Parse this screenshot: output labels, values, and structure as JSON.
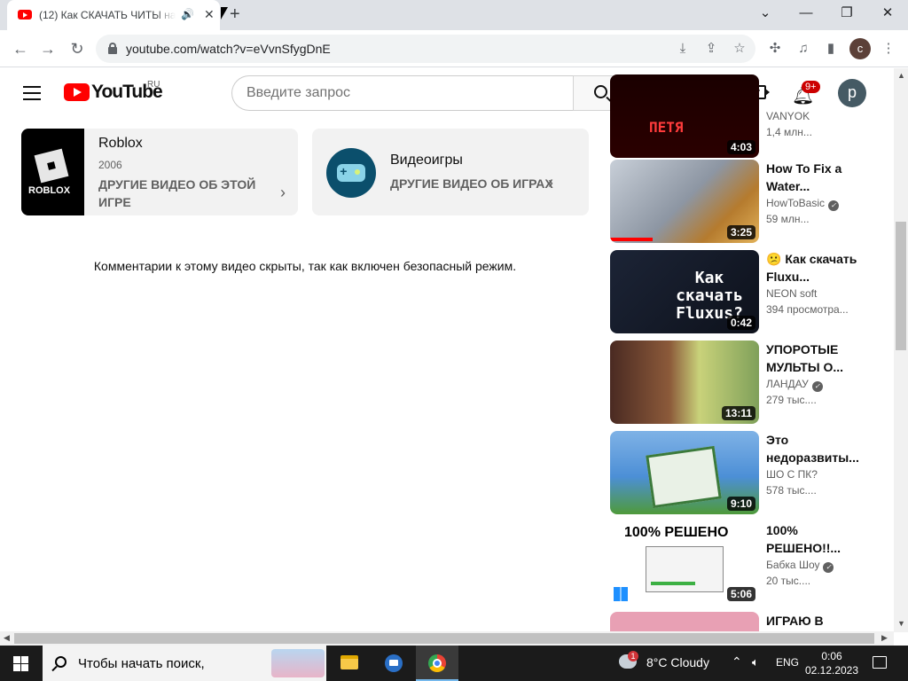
{
  "browser": {
    "tab_title": "(12) Как СКАЧАТЬ ЧИТЫ на",
    "url": "youtube.com/watch?v=eVvnSfygDnE",
    "profile_initial": "c",
    "window_controls": [
      "chevron-down",
      "minimize",
      "restore",
      "close"
    ]
  },
  "youtube": {
    "logo_text": "YouTube",
    "country": "RU",
    "search_placeholder": "Введите запрос",
    "notifications_badge": "9+",
    "avatar_initial": "p",
    "accent": "#ff0000"
  },
  "cards": {
    "roblox": {
      "thumb_label": "ROBLOX",
      "title": "Roblox",
      "year": "2006",
      "link": "ДРУГИЕ ВИДЕО ОБ ЭТОЙ ИГРЕ"
    },
    "games": {
      "title": "Видеоигры",
      "link": "ДРУГИЕ ВИДЕО ОБ ИГРАХ"
    }
  },
  "comments_notice": "Комментарии к этому видео скрыты, так как включен безопасный режим.",
  "recommended": [
    {
      "title": "",
      "thumb_text": "ПЕТЯ",
      "channel": "VANYOK",
      "verified": false,
      "views": "1,4 млн...",
      "duration": "4:03"
    },
    {
      "title": "How To Fix a Water...",
      "thumb_text": "",
      "channel": "HowToBasic",
      "verified": true,
      "views": "59 млн...",
      "duration": "3:25"
    },
    {
      "title": "😕 Как скачать Fluxu...",
      "thumb_text": "Как скачать Fluxus?",
      "channel": "NEON soft",
      "verified": false,
      "views": "394 просмотра...",
      "duration": "0:42"
    },
    {
      "title": "УПОРОТЫЕ МУЛЬТЫ О...",
      "thumb_text": "",
      "channel": "ЛАНДАУ",
      "verified": true,
      "views": "279 тыс....",
      "duration": "13:11"
    },
    {
      "title": "Это недоразвиты...",
      "thumb_text": "",
      "channel": "ШО С ПК?",
      "verified": false,
      "views": "578 тыс....",
      "duration": "9:10"
    },
    {
      "title": "100% РЕШЕНО!!...",
      "thumb_text": "100% РЕШЕНО",
      "channel": "Бабка Шоу",
      "verified": true,
      "views": "20 тыс....",
      "duration": "5:06"
    },
    {
      "title": "ИГРАЮ В",
      "thumb_text": "",
      "channel": "",
      "verified": false,
      "views": "",
      "duration": ""
    }
  ],
  "taskbar": {
    "search_placeholder": "Чтобы начать поиск,",
    "weather_alert_count": "1",
    "weather": "8°C  Cloudy",
    "language": "ENG",
    "time": "0:06",
    "date": "02.12.2023"
  }
}
